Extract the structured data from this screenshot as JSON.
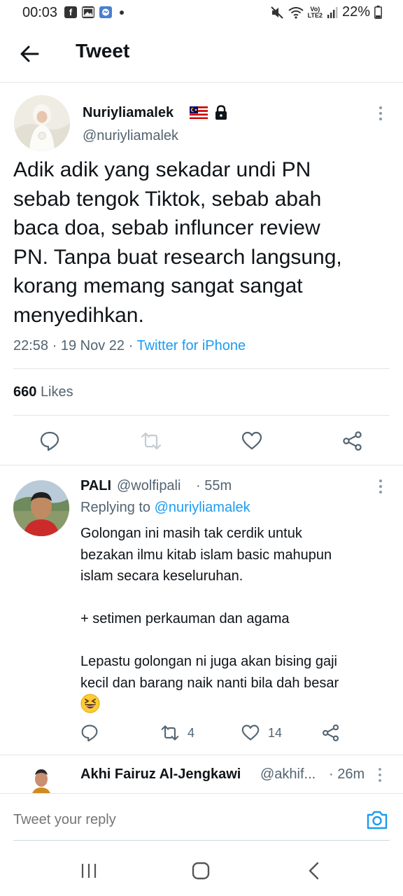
{
  "status_bar": {
    "time": "00:03",
    "app_icons": [
      "facebook",
      "gallery",
      "messenger"
    ],
    "lte_label": "Vo)\nLTE2",
    "battery": "22%"
  },
  "header": {
    "title": "Tweet"
  },
  "main_tweet": {
    "author_name": "Nuriyliamalek",
    "author_handle": "@nuriyliamalek",
    "text": "Adik adik yang sekadar undi PN\nsebab tengok Tiktok, sebab abah\nbaca doa, sebab influncer review\nPN. Tanpa buat research langsung,\nkorang memang sangat sangat\nmenyedihkan.",
    "time": "22:58",
    "date": "19 Nov 22",
    "source": "Twitter for iPhone",
    "sep": "·",
    "likes_count": "660",
    "likes_label": "Likes"
  },
  "reply_1": {
    "author_name": "PALI",
    "author_handle": "@wolfipali",
    "age": "· 55m",
    "replying_label": "Replying to",
    "replying_to": "@nuriyliamalek",
    "text": "Golongan ini masih tak cerdik untuk\nbezakan ilmu kitab islam basic mahupun\nislam secara keseluruhan.\n\n+ setimen perkauman dan agama\n\nLepastu golongan ni juga akan bising gaji\nkecil dan barang naik nanti bila dah besar",
    "emoji": "grinning-squinting-face",
    "retweets": "4",
    "likes": "14"
  },
  "reply_2": {
    "author_name": "Akhi Fairuz Al-Jengkawi",
    "author_handle": "@akhif...",
    "age": "· 26m"
  },
  "composer": {
    "placeholder": "Tweet your reply"
  },
  "colors": {
    "accent": "#1d9bf0",
    "text": "#0f1419",
    "secondary_text": "#536471",
    "border": "#e6e6e6"
  }
}
